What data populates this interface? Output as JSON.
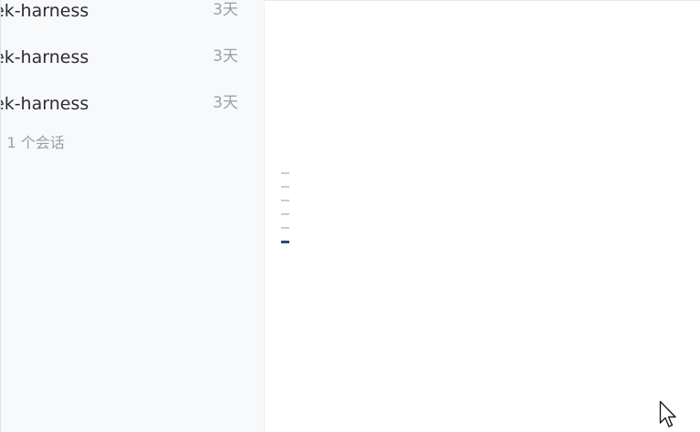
{
  "sidebar": {
    "sessions": [
      {
        "title": "ek-harness",
        "time": "3天"
      },
      {
        "title": "ek-harness",
        "time": "3天"
      },
      {
        "title": "ek-harness",
        "time": "3天"
      }
    ],
    "more_label": "• 1 个会话"
  },
  "scroll_indicator": {
    "mark_count": 6,
    "active_index": 5
  },
  "colors": {
    "sidebar_bg": "#f8f9fb",
    "title_text": "#2b2d31",
    "muted_text": "#9a9ea6",
    "active_mark": "#2e4a6b",
    "inactive_mark": "#c9ccd1"
  }
}
